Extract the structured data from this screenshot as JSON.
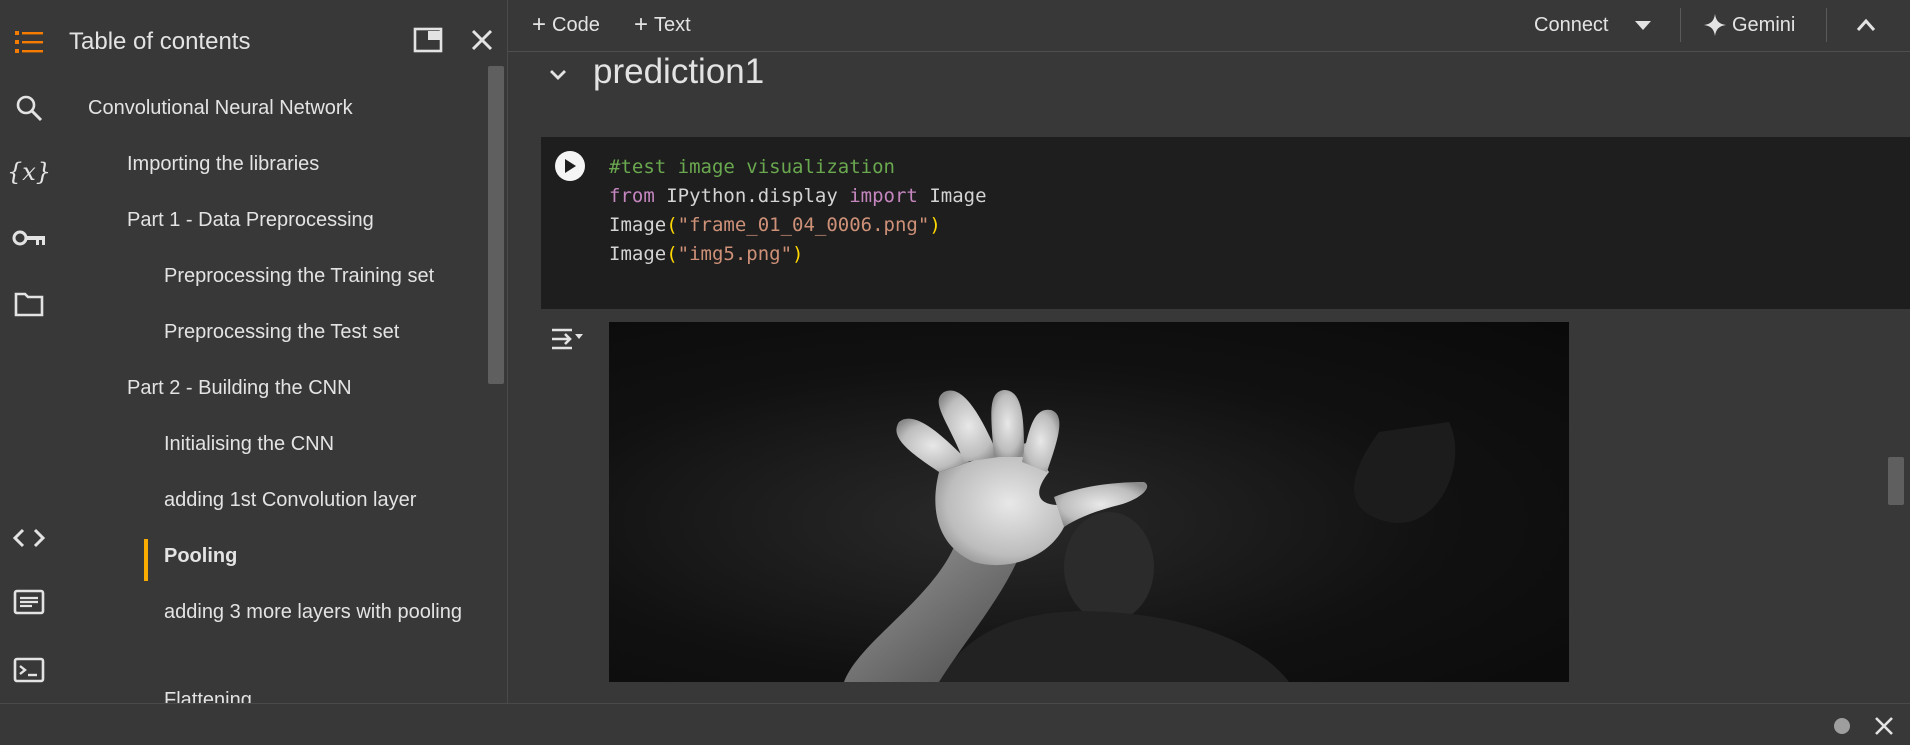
{
  "rail": {
    "icons": [
      "toc-icon",
      "search-icon",
      "variables-icon",
      "secrets-key-icon",
      "folder-icon",
      "code-snippets-icon",
      "command-palette-icon",
      "terminal-icon"
    ],
    "variables_glyph": "{x}"
  },
  "toc": {
    "title": "Table of contents",
    "items": [
      {
        "label": "Convolutional Neural Network",
        "level": 1
      },
      {
        "label": "Importing the libraries",
        "level": 2
      },
      {
        "label": "Part 1 - Data Preprocessing",
        "level": 2
      },
      {
        "label": "Preprocessing the Training set",
        "level": 3
      },
      {
        "label": "Preprocessing the Test set",
        "level": 3
      },
      {
        "label": "Part 2 - Building the CNN",
        "level": 2
      },
      {
        "label": "Initialising the CNN",
        "level": 3
      },
      {
        "label": "adding 1st Convolution layer",
        "level": 3
      },
      {
        "label": "Pooling",
        "level": 3,
        "active": true
      },
      {
        "label": "adding 3 more layers with pooling",
        "level": 3
      },
      {
        "label": "Flattening",
        "level": 3
      }
    ],
    "active_color": "#f9ab00"
  },
  "toolbar": {
    "code_label": "Code",
    "text_label": "Text",
    "connect_label": "Connect",
    "gemini_label": "Gemini"
  },
  "section": {
    "title": "prediction1"
  },
  "cell": {
    "lines": [
      {
        "comment": "#test image visualization"
      },
      {
        "kw1": "from",
        "mod": " IPython.display ",
        "kw2": "import",
        "name": " Image"
      },
      {
        "fn": "Image",
        "open": "(",
        "str": "\"frame_01_04_0006.png\"",
        "close": ")"
      },
      {
        "fn": "Image",
        "open": "(",
        "str": "\"img5.png\"",
        "close": ")"
      }
    ]
  },
  "colors": {
    "background": "#383838",
    "cell_bg": "#1e1e1e",
    "comment": "#6aa84f",
    "keyword": "#c586c0",
    "string": "#ce9178",
    "paren": "#ffd700"
  }
}
